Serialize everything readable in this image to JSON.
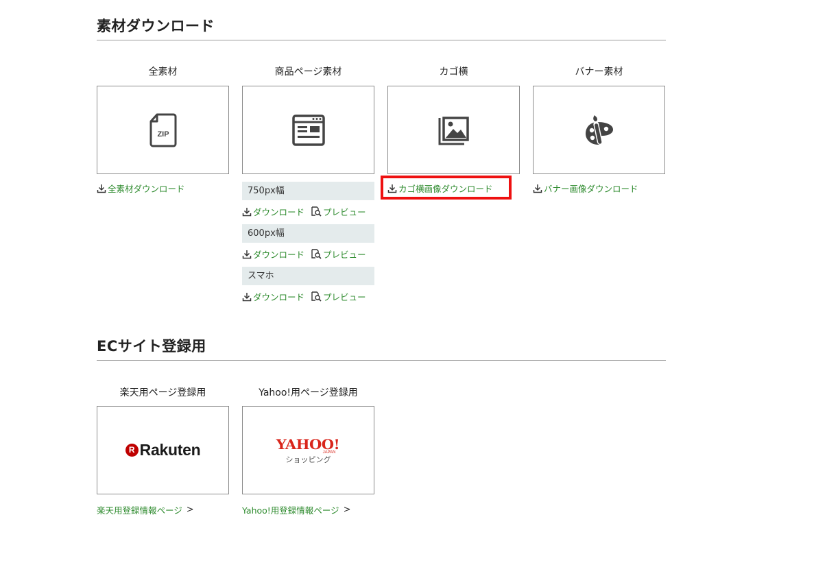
{
  "download_section": {
    "title": "素材ダウンロード",
    "cards": [
      {
        "caption": "全素材",
        "icon": "zip-file-icon",
        "link": "全素材ダウンロード"
      },
      {
        "caption": "商品ページ素材",
        "icon": "web-page-icon",
        "rows": [
          {
            "label": "750px幅",
            "download": "ダウンロード",
            "preview": "プレビュー"
          },
          {
            "label": "600px幅",
            "download": "ダウンロード",
            "preview": "プレビュー"
          },
          {
            "label": "スマホ",
            "download": "ダウンロード",
            "preview": "プレビュー"
          }
        ]
      },
      {
        "caption": "カゴ横",
        "icon": "image-gallery-icon",
        "link": "カゴ横画像ダウンロード",
        "highlighted": true
      },
      {
        "caption": "バナー素材",
        "icon": "palette-icon",
        "link": "バナー画像ダウンロード"
      }
    ]
  },
  "ec_section": {
    "title": "ECサイト登録用",
    "cards": [
      {
        "caption": "楽天用ページ登録用",
        "logo_text": "Rakuten",
        "logo_mark": "R",
        "link": "楽天用登録情報ページ",
        "chevron": ">"
      },
      {
        "caption": "Yahoo!用ページ登録用",
        "logo_text": "YAHOO!",
        "logo_sub": "JAPAN",
        "logo_caption": "ショッピング",
        "link": "Yahoo!用登録情報ページ",
        "chevron": ">"
      }
    ]
  },
  "colors": {
    "link": "#2e8b2e",
    "highlight": "#ee1111",
    "row_bg": "#e4ebec",
    "rakuten": "#bf0000",
    "yahoo": "#d9261c"
  }
}
